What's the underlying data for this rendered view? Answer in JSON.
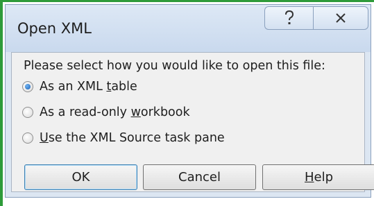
{
  "dialog": {
    "title": "Open XML",
    "help_icon": "help-question-icon",
    "close_icon": "close-x-icon"
  },
  "prompt": "Please select how you would like to open this file:",
  "options": [
    {
      "before": "As an XML ",
      "mnemonic": "t",
      "after": "able",
      "selected": true
    },
    {
      "before": "As a read-only ",
      "mnemonic": "w",
      "after": "orkbook",
      "selected": false
    },
    {
      "before": "",
      "mnemonic": "U",
      "after": "se the XML Source task pane",
      "selected": false
    }
  ],
  "buttons": {
    "ok": "OK",
    "cancel": "Cancel",
    "help": {
      "before": "",
      "mnemonic": "H",
      "after": "elp"
    }
  },
  "colors": {
    "accent_edge": "#2e9b3a",
    "frame": "#dce6f2",
    "client": "#f0f0f0",
    "radio_selected": "#1a5fb4"
  }
}
